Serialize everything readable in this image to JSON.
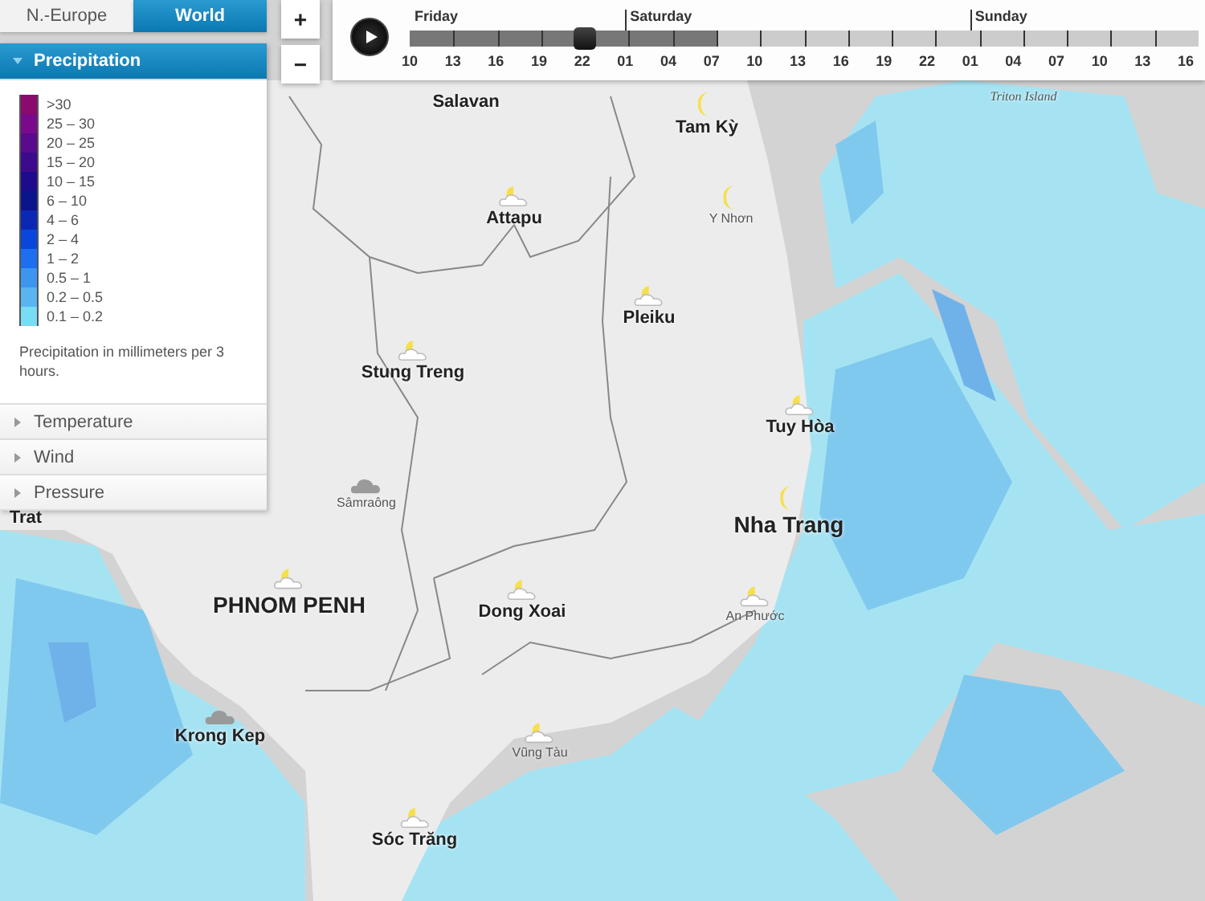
{
  "region_tabs": [
    {
      "label": "N.-Europe",
      "selected": false
    },
    {
      "label": "World",
      "selected": true
    }
  ],
  "zoom_controls": [
    "+",
    "−"
  ],
  "layers": [
    {
      "title": "Precipitation",
      "expanded": true,
      "legend": [
        {
          "label": ">30",
          "color": "#8b0a6e"
        },
        {
          "label": "25 – 30",
          "color": "#7a0a8c"
        },
        {
          "label": "20 – 25",
          "color": "#5a0a8c"
        },
        {
          "label": "15 – 20",
          "color": "#3c0a8c"
        },
        {
          "label": "10 – 15",
          "color": "#1e0a8c"
        },
        {
          "label": "6 – 10",
          "color": "#0a148c"
        },
        {
          "label": "4 – 6",
          "color": "#0a28b4"
        },
        {
          "label": "2 – 4",
          "color": "#0a46dc"
        },
        {
          "label": "1 – 2",
          "color": "#1e6ef0"
        },
        {
          "label": "0.5 – 1",
          "color": "#3c96f0"
        },
        {
          "label": "0.2 – 0.5",
          "color": "#5ab4f0"
        },
        {
          "label": "0.1 – 0.2",
          "color": "#78dcf5"
        }
      ],
      "note": "Precipitation in millimeters per 3 hours."
    },
    {
      "title": "Temperature",
      "expanded": false
    },
    {
      "title": "Wind",
      "expanded": false
    },
    {
      "title": "Pressure",
      "expanded": false
    }
  ],
  "timeline": {
    "playing": false,
    "level": 0.222,
    "buffer": {
      "level": 0.389
    },
    "days": [
      {
        "day": "Friday",
        "hours": [
          "10",
          "13",
          "16",
          "19",
          "22"
        ]
      },
      {
        "day": "Saturday",
        "hours": [
          "01",
          "04",
          "07",
          "10",
          "13",
          "16",
          "19",
          "22"
        ]
      },
      {
        "day": "Sunday",
        "hours": [
          "01",
          "04",
          "07",
          "10",
          "13",
          "16"
        ]
      }
    ]
  },
  "places": [
    {
      "name": "Triton Island",
      "kind": "island"
    },
    {
      "name": "Salavan",
      "kind": "city"
    },
    {
      "name": "Tam Kỳ",
      "kind": "city",
      "weather": {
        "kind": "moon"
      }
    },
    {
      "name": "Attapu",
      "kind": "city",
      "weather": {
        "kind": "sun-cloud"
      }
    },
    {
      "name": "Y Nhơn",
      "kind": "town",
      "weather": {
        "kind": "moon"
      }
    },
    {
      "name": "Pleiku",
      "kind": "city",
      "weather": {
        "kind": "sun-cloud"
      }
    },
    {
      "name": "Stung Treng",
      "kind": "city",
      "weather": {
        "kind": "sun-cloud"
      }
    },
    {
      "name": "Tuy Hòa",
      "kind": "city",
      "weather": {
        "kind": "sun-cloud"
      }
    },
    {
      "name": "Sâmraông",
      "kind": "town",
      "weather": {
        "kind": "cloud"
      }
    },
    {
      "name": "Nha Trang",
      "kind": "large",
      "weather": {
        "kind": "moon"
      }
    },
    {
      "name": "Trat",
      "kind": "city"
    },
    {
      "name": "PHNOM PENH",
      "kind": "large",
      "weather": {
        "kind": "sun-cloud"
      }
    },
    {
      "name": "Dong Xoai",
      "kind": "city",
      "weather": {
        "kind": "sun-cloud"
      }
    },
    {
      "name": "An Phước",
      "kind": "town",
      "weather": {
        "kind": "sun-cloud"
      }
    },
    {
      "name": "Krong Kep",
      "kind": "city",
      "weather": {
        "kind": "cloud"
      }
    },
    {
      "name": "Vũng Tàu",
      "kind": "town",
      "weather": {
        "kind": "sun-cloud"
      }
    },
    {
      "name": "Sóc Trăng",
      "kind": "city",
      "weather": {
        "kind": "sun-cloud"
      }
    }
  ]
}
